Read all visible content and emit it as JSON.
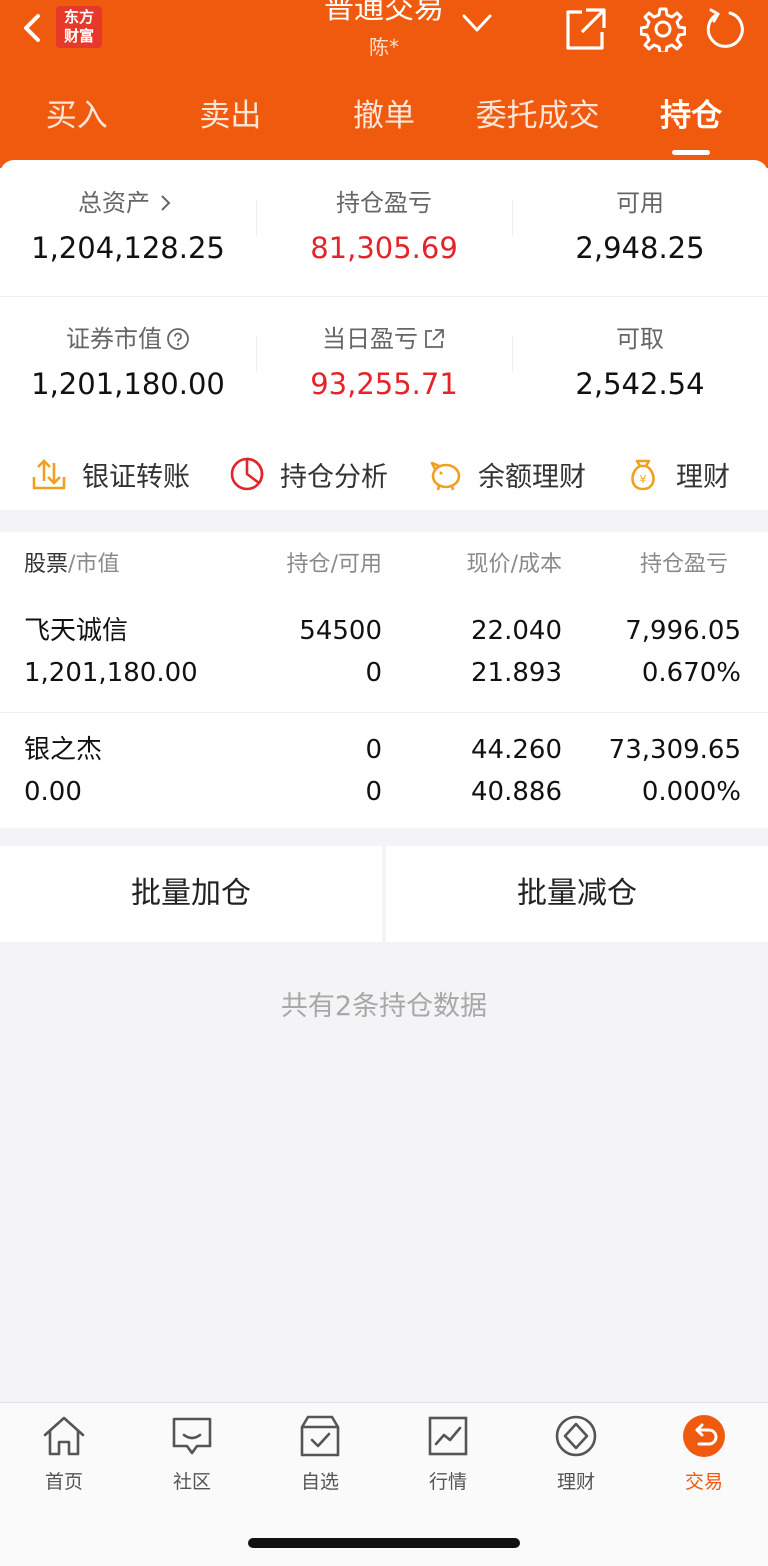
{
  "header": {
    "logo_line1": "东方",
    "logo_line2": "财富",
    "title": "普通交易",
    "subtitle": "陈*",
    "tabs": [
      {
        "label": "买入"
      },
      {
        "label": "卖出"
      },
      {
        "label": "撤单"
      },
      {
        "label": "委托成交"
      },
      {
        "label": "持仓",
        "active": true
      }
    ]
  },
  "summary": {
    "row1": [
      {
        "label": "总资产",
        "value": "1,204,128.25"
      },
      {
        "label": "持仓盈亏",
        "value": "81,305.69"
      },
      {
        "label": "可用",
        "value": "2,948.25"
      }
    ],
    "row2": [
      {
        "label": "证券市值",
        "value": "1,201,180.00"
      },
      {
        "label": "当日盈亏",
        "value": "93,255.71"
      },
      {
        "label": "可取",
        "value": "2,542.54"
      }
    ]
  },
  "quick_actions": [
    {
      "label": "银证转账",
      "icon": "transfer-icon"
    },
    {
      "label": "持仓分析",
      "icon": "pie-chart-icon"
    },
    {
      "label": "余额理财",
      "icon": "piggy-bank-icon"
    },
    {
      "label": "理财",
      "icon": "money-bag-icon"
    }
  ],
  "table": {
    "headers": {
      "col1_a": "股票",
      "col1_b": "市值",
      "col2_a": "持仓",
      "col2_b": "可用",
      "col3_a": "现价",
      "col3_b": "成本",
      "col4": "持仓盈亏"
    },
    "rows": [
      {
        "name": "飞天诚信",
        "market_value": "1,201,180.00",
        "position": "54500",
        "available": "0",
        "price": "22.040",
        "cost": "21.893",
        "pnl": "7,996.05",
        "pnl_pct": "0.670%"
      },
      {
        "name": "银之杰",
        "market_value": "0.00",
        "position": "0",
        "available": "0",
        "price": "44.260",
        "cost": "40.886",
        "pnl": "73,309.65",
        "pnl_pct": "0.000%"
      }
    ]
  },
  "batch": {
    "add_label": "批量加仓",
    "reduce_label": "批量减仓"
  },
  "footnote": "共有2条持仓数据",
  "bottom_nav": [
    {
      "label": "首页",
      "icon": "home-icon"
    },
    {
      "label": "社区",
      "icon": "chat-icon"
    },
    {
      "label": "自选",
      "icon": "watchlist-icon"
    },
    {
      "label": "行情",
      "icon": "market-chart-icon"
    },
    {
      "label": "理财",
      "icon": "wealth-icon"
    },
    {
      "label": "交易",
      "icon": "trade-icon",
      "active": true
    }
  ],
  "colors": {
    "brand": "#ef5a0f",
    "gain": "#e3242b"
  }
}
